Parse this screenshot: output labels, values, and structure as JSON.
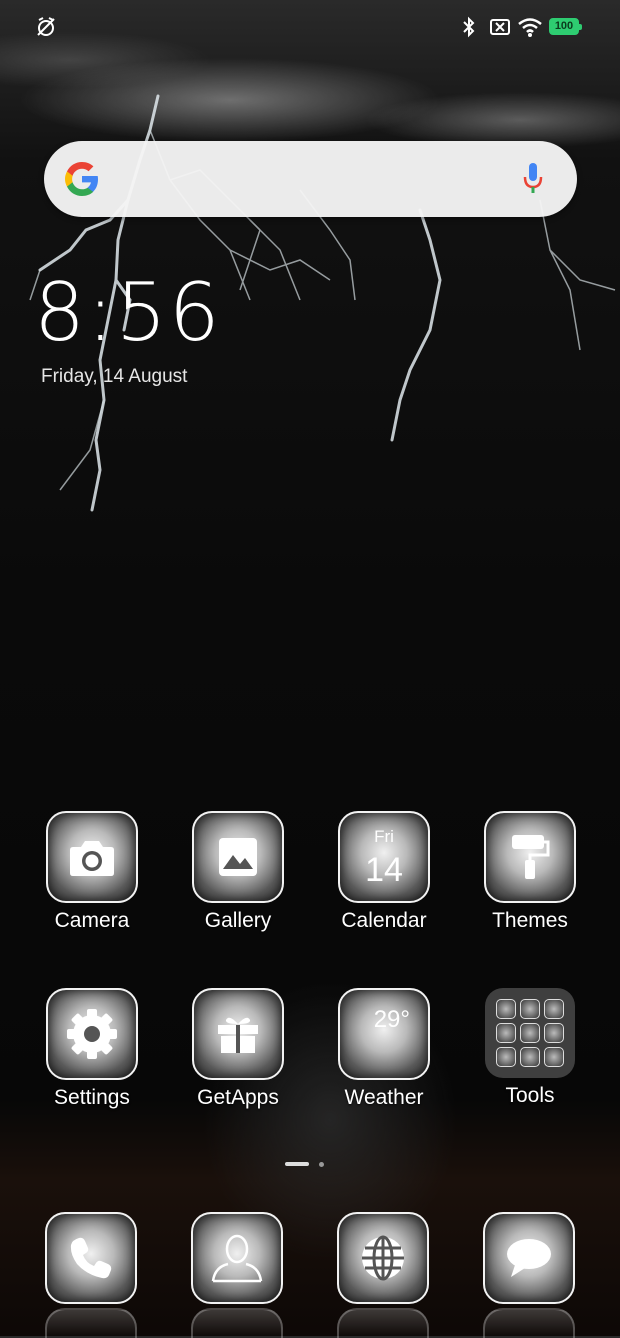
{
  "status_bar": {
    "battery": "100",
    "icons": [
      "no-alarm-icon",
      "bluetooth-icon",
      "sim-x-icon",
      "wifi-icon",
      "battery-icon"
    ]
  },
  "search": {
    "icons": [
      "google-g-icon",
      "mic-icon"
    ]
  },
  "clock": {
    "time": "8:56",
    "date": "Friday, 14 August"
  },
  "apps_row1": [
    {
      "label": "Camera",
      "icon": "camera-icon"
    },
    {
      "label": "Gallery",
      "icon": "gallery-icon"
    },
    {
      "label": "Calendar",
      "icon": "calendar-icon",
      "day": "Fri",
      "num": "14"
    },
    {
      "label": "Themes",
      "icon": "paint-roller-icon"
    }
  ],
  "apps_row2": [
    {
      "label": "Settings",
      "icon": "gear-icon"
    },
    {
      "label": "GetApps",
      "icon": "gift-icon"
    },
    {
      "label": "Weather",
      "icon": "weather-icon",
      "temp": "29°"
    },
    {
      "label": "Tools",
      "icon": "folder-icon"
    }
  ],
  "dock": [
    {
      "icon": "phone-icon"
    },
    {
      "icon": "contacts-icon"
    },
    {
      "icon": "browser-globe-icon"
    },
    {
      "icon": "messages-icon"
    }
  ],
  "colors": {
    "battery": "#2ecc71",
    "google_blue": "#4285F4",
    "google_red": "#EA4335",
    "google_yellow": "#FBBC05",
    "google_green": "#34A853"
  }
}
